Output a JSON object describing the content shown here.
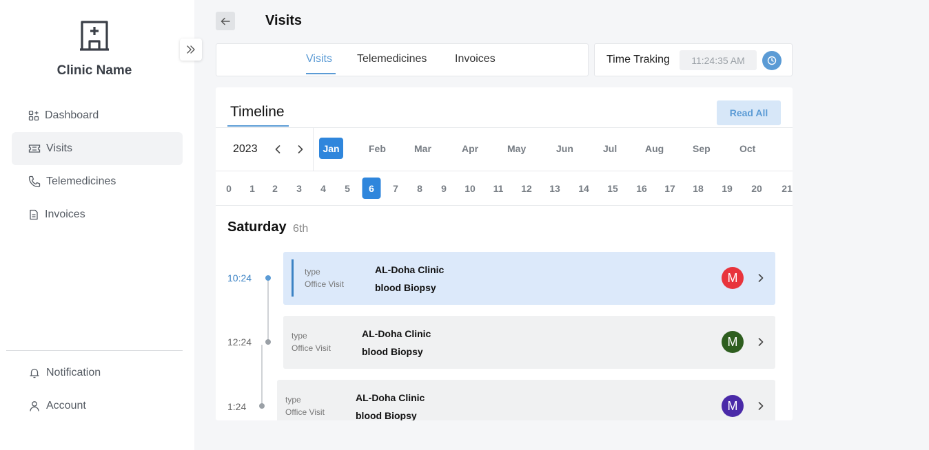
{
  "sidebar": {
    "clinic_name": "Clinic Name",
    "nav": [
      {
        "label": "Dashboard",
        "icon": "dashboard-icon"
      },
      {
        "label": "Visits",
        "icon": "ticket-icon",
        "active": true
      },
      {
        "label": "Telemedicines",
        "icon": "phone-icon"
      },
      {
        "label": "Invoices",
        "icon": "document-icon"
      }
    ],
    "bottom": [
      {
        "label": "Notification",
        "icon": "bell-icon"
      },
      {
        "label": "Account",
        "icon": "user-icon"
      }
    ]
  },
  "header": {
    "title": "Visits"
  },
  "tabs": {
    "items": [
      "Visits",
      "Telemedicines",
      "Invoices"
    ],
    "active": "Visits"
  },
  "time_tracking": {
    "label": "Time Traking",
    "value": "11:24:35 AM"
  },
  "timeline": {
    "title": "Timeline",
    "read_all": "Read All",
    "year": "2023",
    "months": [
      "Jan",
      "Feb",
      "Mar",
      "Apr",
      "May",
      "Jun",
      "Jul",
      "Aug",
      "Sep",
      "Oct"
    ],
    "active_month": "Jan",
    "days": [
      "0",
      "1",
      "2",
      "3",
      "4",
      "5",
      "6",
      "7",
      "8",
      "9",
      "10",
      "11",
      "12",
      "13",
      "14",
      "15",
      "16",
      "17",
      "18",
      "19",
      "20",
      "21"
    ],
    "active_day": "6",
    "day_name": "Saturday",
    "day_ordinal": "6th",
    "visits": [
      {
        "time": "10:24",
        "type_label": "type",
        "type_value": "Office Visit",
        "clinic": "AL-Doha Clinic",
        "procedure": "blood Biopsy",
        "avatar": "M",
        "avatar_color": "#e8343c"
      },
      {
        "time": "12:24",
        "type_label": "type",
        "type_value": "Office Visit",
        "clinic": "AL-Doha Clinic",
        "procedure": "blood Biopsy",
        "avatar": "M",
        "avatar_color": "#2e5e1f"
      },
      {
        "time": "1:24",
        "type_label": "type",
        "type_value": "Office Visit",
        "clinic": "AL-Doha Clinic",
        "procedure": "blood Biopsy",
        "avatar": "M",
        "avatar_color": "#4a2aa8"
      }
    ]
  },
  "colors": {
    "accent": "#2f86dc",
    "accent_light": "#5b9bd5"
  }
}
